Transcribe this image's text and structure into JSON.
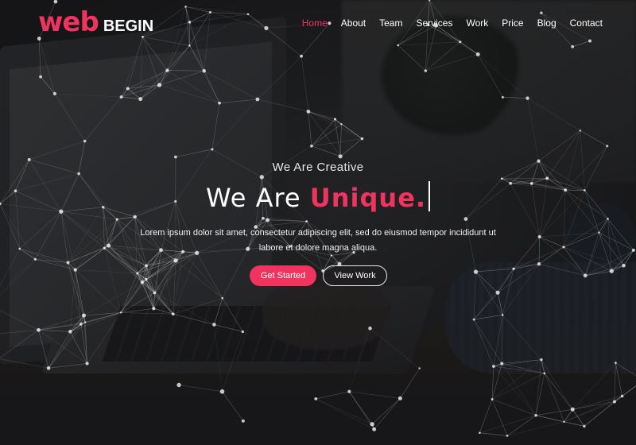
{
  "theme": {
    "accent": "#f0345f",
    "text": "#ffffff"
  },
  "logo": {
    "part1": "web",
    "part2": "BEGIN"
  },
  "nav": {
    "items": [
      {
        "label": "Home",
        "active": true
      },
      {
        "label": "About",
        "active": false
      },
      {
        "label": "Team",
        "active": false
      },
      {
        "label": "Services",
        "active": false
      },
      {
        "label": "Work",
        "active": false
      },
      {
        "label": "Price",
        "active": false
      },
      {
        "label": "Blog",
        "active": false
      },
      {
        "label": "Contact",
        "active": false
      }
    ]
  },
  "hero": {
    "eyebrow": "We Are Creative",
    "headline_prefix": "We Are ",
    "headline_accent": "Unique.",
    "lead": "Lorem ipsum dolor sit amet, consectetur adipiscing elit, sed do eiusmod tempor incididunt ut labore et dolore magna aliqua.",
    "primary_button": "Get Started",
    "secondary_button": "View Work"
  },
  "background": {
    "image_subject": "laptop-on-desk-photo",
    "effect": "particle-network"
  }
}
